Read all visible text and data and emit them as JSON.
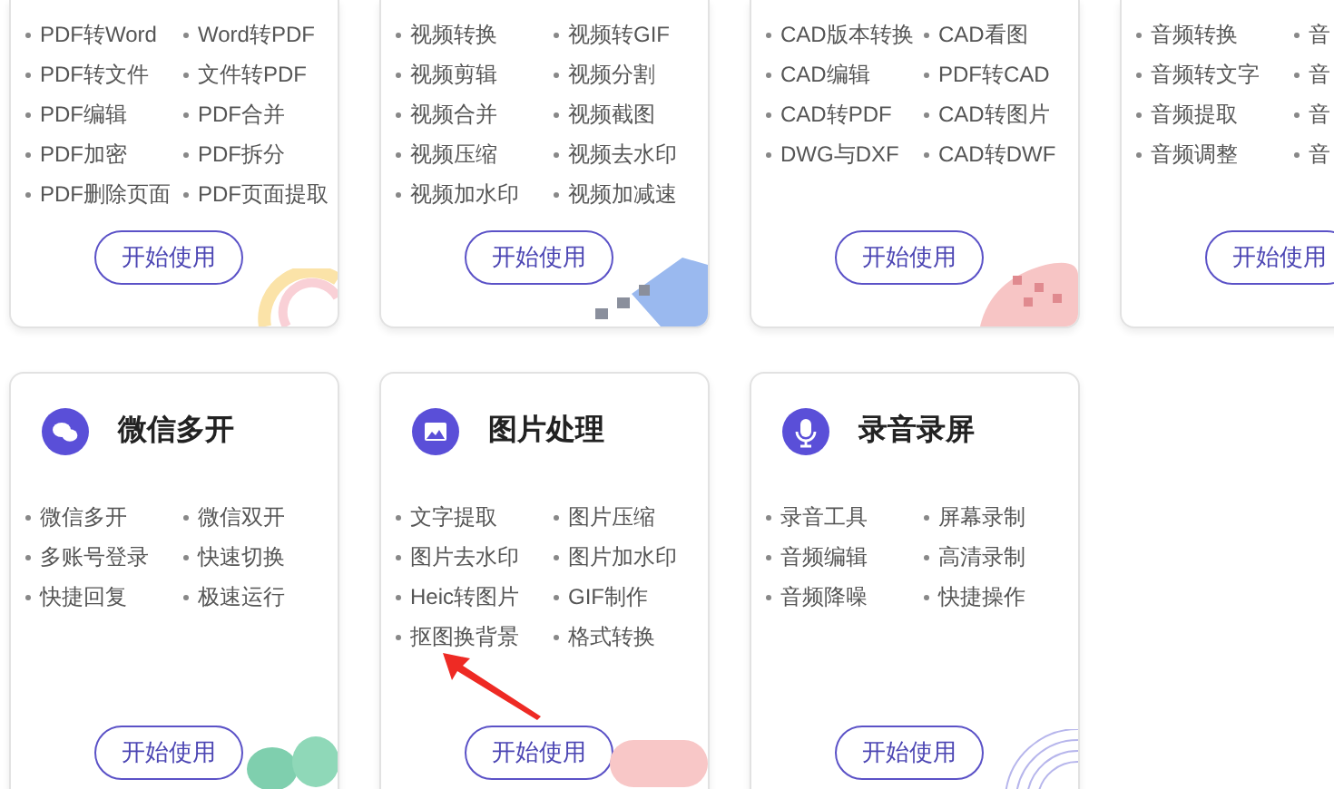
{
  "top_cards": [
    {
      "items": [
        "PDF转Word",
        "Word转PDF",
        "PDF转文件",
        "文件转PDF",
        "PDF编辑",
        "PDF合并",
        "PDF加密",
        "PDF拆分",
        "PDF删除页面",
        "PDF页面提取"
      ],
      "button": "开始使用"
    },
    {
      "items": [
        "视频转换",
        "视频转GIF",
        "视频剪辑",
        "视频分割",
        "视频合并",
        "视频截图",
        "视频压缩",
        "视频去水印",
        "视频加水印",
        "视频加减速"
      ],
      "button": "开始使用"
    },
    {
      "items": [
        "CAD版本转换",
        "CAD看图",
        "CAD编辑",
        "PDF转CAD",
        "CAD转PDF",
        "CAD转图片",
        "DWG与DXF",
        "CAD转DWF"
      ],
      "button": "开始使用"
    },
    {
      "items": [
        "音频转换",
        "音",
        "音频转文字",
        "音",
        "音频提取",
        "音",
        "音频调整",
        "音"
      ],
      "button": "开始使用"
    }
  ],
  "bottom_cards": [
    {
      "kind": "chat",
      "title": "微信多开",
      "items": [
        "微信多开",
        "微信双开",
        "多账号登录",
        "快速切换",
        "快捷回复",
        "极速运行"
      ],
      "button": "开始使用"
    },
    {
      "kind": "image",
      "title": "图片处理",
      "items": [
        "文字提取",
        "图片压缩",
        "图片去水印",
        "图片加水印",
        "Heic转图片",
        "GIF制作",
        "抠图换背景",
        "格式转换"
      ],
      "button": "开始使用"
    },
    {
      "kind": "mic",
      "title": "录音录屏",
      "items": [
        "录音工具",
        "屏幕录制",
        "音频编辑",
        "高清录制",
        "音频降噪",
        "快捷操作"
      ],
      "button": "开始使用"
    }
  ]
}
